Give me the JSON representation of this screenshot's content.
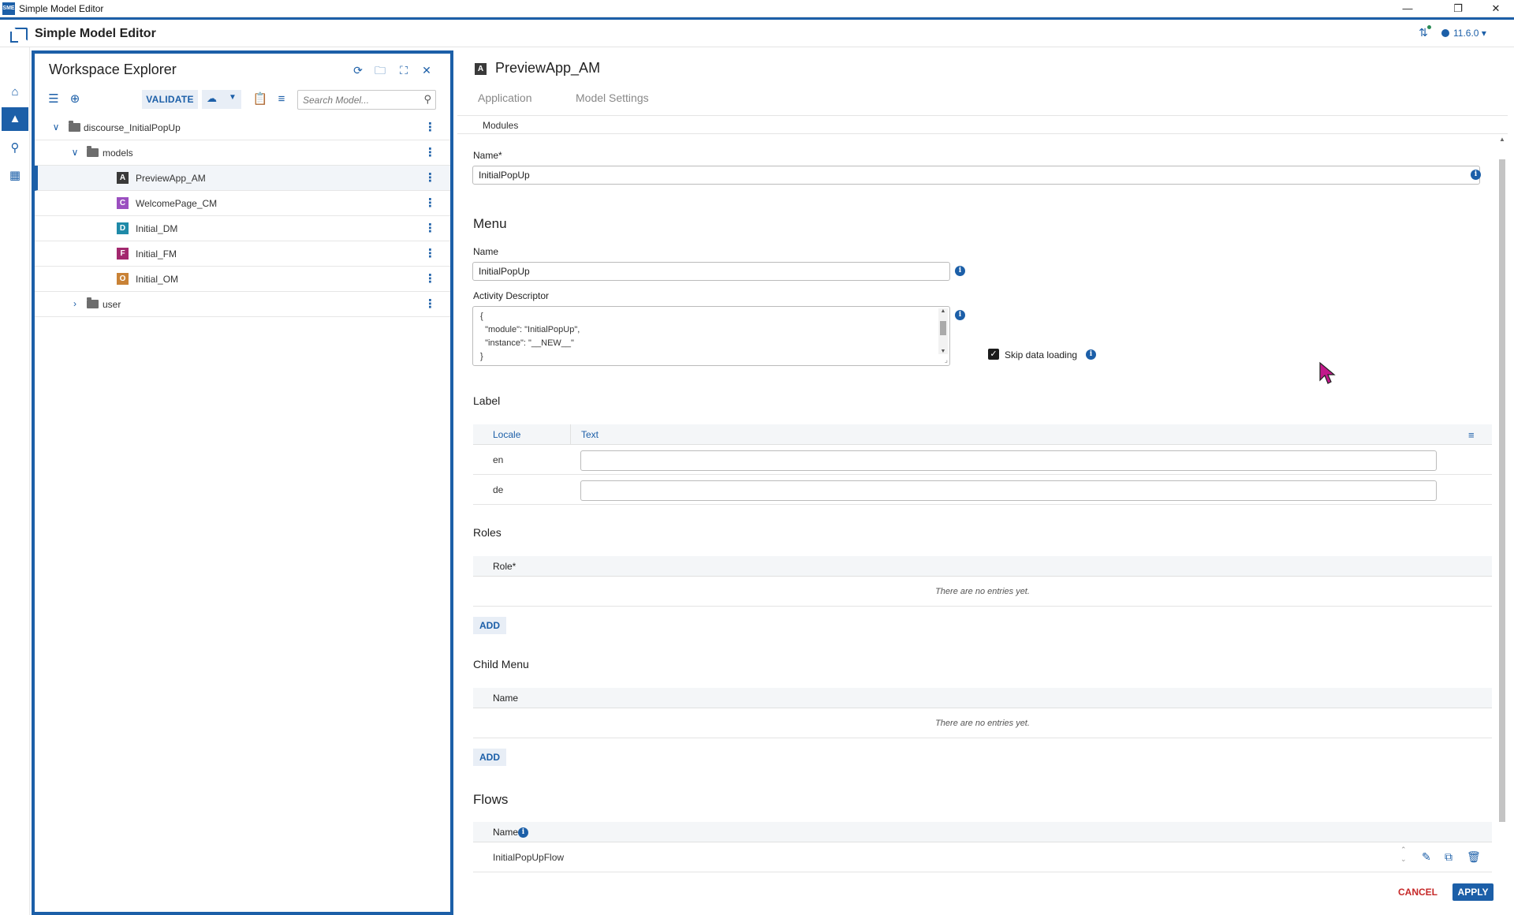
{
  "window": {
    "title": "Simple Model Editor",
    "app_icon_text": "SME"
  },
  "header": {
    "app_title": "Simple Model Editor",
    "version": "11.6.0"
  },
  "explorer": {
    "title": "Workspace Explorer",
    "validate_label": "VALIDATE",
    "search_placeholder": "Search Model...",
    "tree": [
      {
        "label": "discourse_InitialPopUp",
        "type": "folder",
        "expanded": true
      },
      {
        "label": "models",
        "type": "folder",
        "expanded": true
      },
      {
        "label": "PreviewApp_AM",
        "badge": "A",
        "badge_color": "#3a3a3a",
        "selected": true
      },
      {
        "label": "WelcomePage_CM",
        "badge": "C",
        "badge_color": "#9b4fc0"
      },
      {
        "label": "Initial_DM",
        "badge": "D",
        "badge_color": "#1f8aa8"
      },
      {
        "label": "Initial_FM",
        "badge": "F",
        "badge_color": "#a3286e"
      },
      {
        "label": "Initial_OM",
        "badge": "O",
        "badge_color": "#c98236"
      },
      {
        "label": "user",
        "type": "folder",
        "expanded": false
      }
    ]
  },
  "editor": {
    "badge": "A",
    "title": "PreviewApp_AM",
    "tabs": [
      "Application",
      "Model Settings"
    ],
    "subnav": "Modules",
    "name_label": "Name*",
    "name_value": "InitialPopUp",
    "menu": {
      "heading": "Menu",
      "name_label": "Name",
      "name_value": "InitialPopUp",
      "descriptor_label": "Activity Descriptor",
      "descriptor_value": "{\n  \"module\": \"InitialPopUp\",\n  \"instance\": \"__NEW__\"\n}",
      "skip_label": "Skip data loading",
      "skip_checked": true
    },
    "label_section": {
      "heading": "Label",
      "col_locale": "Locale",
      "col_text": "Text",
      "rows": [
        {
          "locale": "en",
          "text": ""
        },
        {
          "locale": "de",
          "text": ""
        }
      ]
    },
    "roles": {
      "heading": "Roles",
      "col": "Role*",
      "empty": "There are no entries yet.",
      "add": "ADD"
    },
    "child_menu": {
      "heading": "Child Menu",
      "col": "Name",
      "empty": "There are no entries yet.",
      "add": "ADD"
    },
    "flows": {
      "heading": "Flows",
      "col": "Name",
      "rows": [
        "InitialPopUpFlow"
      ]
    },
    "cancel": "CANCEL",
    "apply": "APPLY"
  },
  "colors": {
    "accent": "#1c5fa8",
    "danger": "#c62828",
    "cursor": "#c2188b"
  }
}
